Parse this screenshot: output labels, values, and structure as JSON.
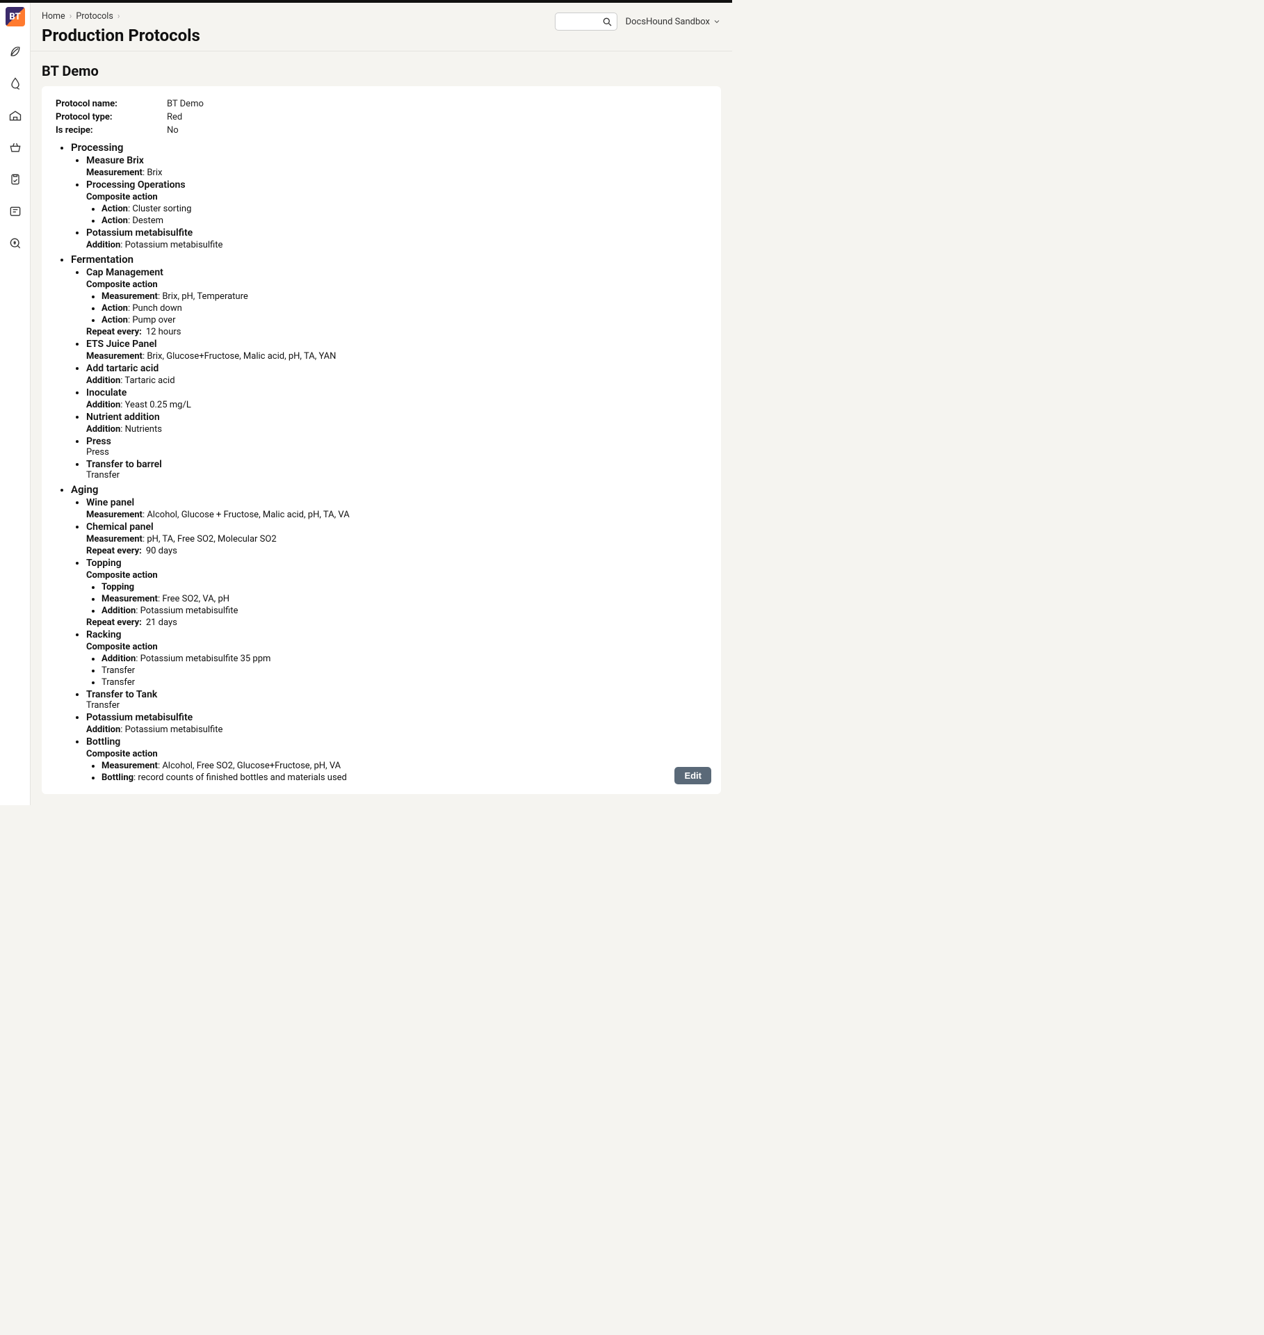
{
  "breadcrumb": {
    "home": "Home",
    "protocols": "Protocols"
  },
  "page_title": "Production Protocols",
  "workspace": "DocsHound Sandbox",
  "protocol_header": "BT Demo",
  "meta": {
    "name_label": "Protocol name:",
    "name_value": "BT Demo",
    "type_label": "Protocol type:",
    "type_value": "Red",
    "recipe_label": "Is recipe:",
    "recipe_value": "No"
  },
  "labels": {
    "measurement": "Measurement",
    "composite": "Composite action",
    "action": "Action",
    "addition": "Addition",
    "repeat": "Repeat every:",
    "press": "Press",
    "transfer": "Transfer",
    "topping": "Topping",
    "bottling": "Bottling"
  },
  "phases": {
    "processing": {
      "title": "Processing",
      "measure_brix": {
        "title": "Measure Brix",
        "measurement": "Brix"
      },
      "operations": {
        "title": "Processing Operations",
        "action1": "Cluster sorting",
        "action2": "Destem"
      },
      "kms": {
        "title": "Potassium metabisulfite",
        "addition": "Potassium metabisulfite"
      }
    },
    "fermentation": {
      "title": "Fermentation",
      "cap": {
        "title": "Cap Management",
        "measurement": "Brix, pH, Temperature",
        "action1": "Punch down",
        "action2": "Pump over",
        "repeat": "12 hours"
      },
      "ets": {
        "title": "ETS Juice Panel",
        "measurement": "Brix, Glucose+Fructose, Malic acid, pH, TA, YAN"
      },
      "tartaric": {
        "title": "Add tartaric acid",
        "addition": "Tartaric acid"
      },
      "inoculate": {
        "title": "Inoculate",
        "addition": "Yeast 0.25 mg/L"
      },
      "nutrient": {
        "title": "Nutrient addition",
        "addition": "Nutrients"
      },
      "press": {
        "title": "Press"
      },
      "transfer_barrel": {
        "title": "Transfer to barrel"
      }
    },
    "aging": {
      "title": "Aging",
      "wine_panel": {
        "title": "Wine panel",
        "measurement": "Alcohol, Glucose + Fructose, Malic acid, pH, TA, VA"
      },
      "chem_panel": {
        "title": "Chemical panel",
        "measurement": "pH, TA, Free SO2, Molecular SO2",
        "repeat": "90 days"
      },
      "topping": {
        "title": "Topping",
        "sub_topping": "Topping",
        "measurement": "Free SO2, VA, pH",
        "addition": "Potassium metabisulfite",
        "repeat": "21 days"
      },
      "racking": {
        "title": "Racking",
        "addition": "Potassium metabisulfite 35 ppm",
        "t1": "Transfer",
        "t2": "Transfer"
      },
      "transfer_tank": {
        "title": "Transfer to Tank"
      },
      "kms": {
        "title": "Potassium metabisulfite",
        "addition": "Potassium metabisulfite"
      },
      "bottling": {
        "title": "Bottling",
        "measurement": "Alcohol, Free SO2, Glucose+Fructose, pH, VA",
        "bottling_note": "record counts of finished bottles and materials used"
      }
    }
  },
  "edit_button": "Edit"
}
